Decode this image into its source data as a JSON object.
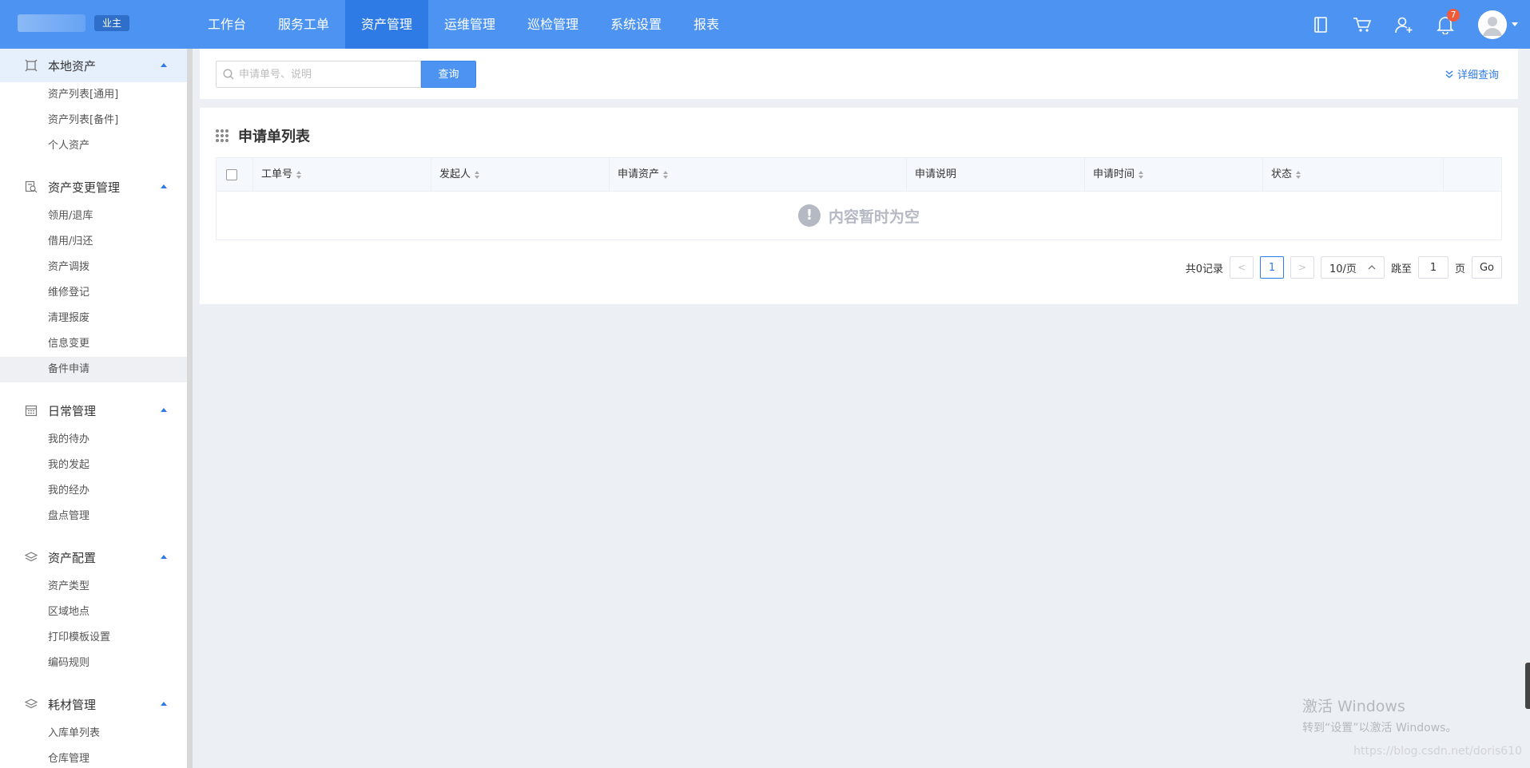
{
  "header": {
    "role_badge": "业主",
    "nav": [
      {
        "label": "工作台"
      },
      {
        "label": "服务工单"
      },
      {
        "label": "资产管理",
        "active": true
      },
      {
        "label": "运维管理"
      },
      {
        "label": "巡检管理"
      },
      {
        "label": "系统设置"
      },
      {
        "label": "报表"
      }
    ],
    "notification_count": "7",
    "icons": [
      "book-icon",
      "cart-icon",
      "add-user-icon",
      "bell-icon",
      "avatar"
    ]
  },
  "sidebar": {
    "groups": [
      {
        "label": "本地资产",
        "icon": "frame-icon",
        "active": true,
        "items": [
          "资产列表[通用]",
          "资产列表[备件]",
          "个人资产"
        ]
      },
      {
        "label": "资产变更管理",
        "icon": "search-doc-icon",
        "items": [
          "领用/退库",
          "借用/归还",
          "资产调拨",
          "维修登记",
          "清理报废",
          "信息变更",
          "备件申请"
        ],
        "active_item": "备件申请"
      },
      {
        "label": "日常管理",
        "icon": "calendar-icon",
        "items": [
          "我的待办",
          "我的发起",
          "我的经办",
          "盘点管理"
        ]
      },
      {
        "label": "资产配置",
        "icon": "layers-icon",
        "items": [
          "资产类型",
          "区域地点",
          "打印模板设置",
          "编码规则"
        ]
      },
      {
        "label": "耗材管理",
        "icon": "layers-icon",
        "items": [
          "入库单列表",
          "仓库管理"
        ]
      }
    ]
  },
  "search": {
    "placeholder": "申请单号、说明",
    "button_label": "查询",
    "detail_label": "详细查询"
  },
  "list": {
    "title": "申请单列表",
    "columns": [
      {
        "label": "工单号",
        "sortable": true
      },
      {
        "label": "发起人",
        "sortable": true
      },
      {
        "label": "申请资产",
        "sortable": true
      },
      {
        "label": "申请说明",
        "sortable": false
      },
      {
        "label": "申请时间",
        "sortable": true
      },
      {
        "label": "状态",
        "sortable": true
      }
    ],
    "empty_text": "内容暂时为空"
  },
  "pagination": {
    "total_text": "共0记录",
    "current_page": "1",
    "page_size": "10/页",
    "jump_label": "跳至",
    "jump_value": "1",
    "page_unit": "页",
    "go_label": "Go"
  },
  "watermark": {
    "line1": "激活 Windows",
    "line2": "转到“设置”以激活 Windows。",
    "url": "https://blog.csdn.net/doris610"
  },
  "colors": {
    "primary": "#4d94f2",
    "nav_active": "#2e7be6",
    "badge": "#f05a3a"
  }
}
